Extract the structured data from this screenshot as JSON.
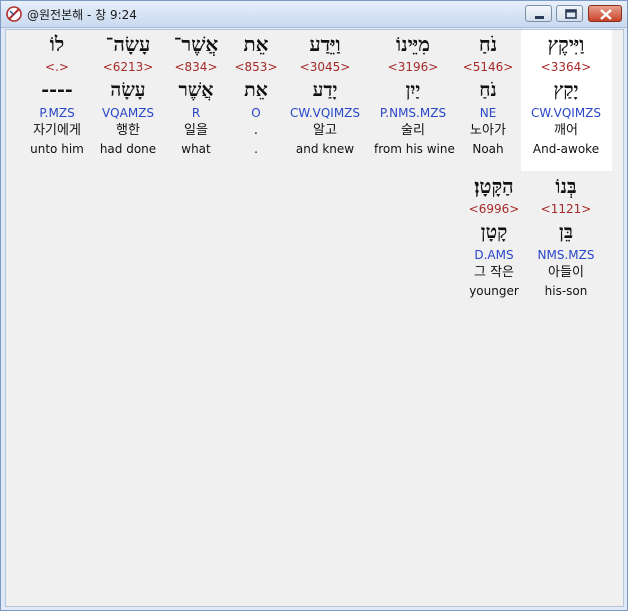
{
  "window": {
    "title": "@원전본해 - 창 9:24",
    "colors": {
      "strong": "#a52a2a",
      "morph": "#2a46c8",
      "highlight": "#ffffff"
    }
  },
  "words": [
    {
      "heb": "וַיִּיקֶץ",
      "strong": "<3364>",
      "heb2": "יָקַץ",
      "morph": "CW.VQIMZS",
      "kor": "깨어",
      "eng": "And-awoke",
      "selected": true
    },
    {
      "heb": "נֹחַ",
      "strong": "<5146>",
      "heb2": "נֹחַ",
      "morph": "NE",
      "kor": "노아가",
      "eng": "Noah"
    },
    {
      "heb": "מִיֵּינוֹ",
      "strong": "<3196>",
      "heb2": "יַיִן",
      "morph": "P.NMS.MZS",
      "kor": "술리",
      "eng": "from his wine"
    },
    {
      "heb": "וַיֵּדַע",
      "strong": "<3045>",
      "heb2": "יָדַע",
      "morph": "CW.VQIMZS",
      "kor": "알고",
      "eng": "and knew"
    },
    {
      "heb": "אֵת",
      "strong": "<853>",
      "heb2": "אֵת",
      "morph": "O",
      "kor": ".",
      "eng": "."
    },
    {
      "heb": "אֲשֶׁר־",
      "strong": "<834>",
      "heb2": "אֲשֶׁר",
      "morph": "R",
      "kor": "일을",
      "eng": "what"
    },
    {
      "heb": "עָשָׂה־",
      "strong": "<6213>",
      "heb2": "עָשָׂה",
      "morph": "VQAMZS",
      "kor": "행한",
      "eng": "had done"
    },
    {
      "heb": "לוֹ",
      "strong": "<.>",
      "heb2": "----",
      "morph": "P.MZS",
      "kor": "자기에게",
      "eng": "unto him"
    },
    {
      "heb": "בְּנוֹ",
      "strong": "<1121>",
      "heb2": "בֵּן",
      "morph": "NMS.MZS",
      "kor": "아들이",
      "eng": "his-son"
    },
    {
      "heb": "הַקָּטָן׃",
      "strong": "<6996>",
      "heb2": "קָטָן",
      "morph": "D.AMS",
      "kor": "그 작은",
      "eng": "younger"
    }
  ]
}
